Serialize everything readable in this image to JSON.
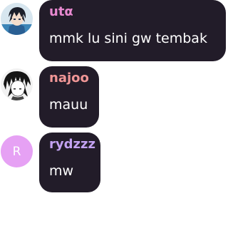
{
  "messages": [
    {
      "username": "utα",
      "username_color": "#e889d0",
      "text": "mmk lu sini gw tembak",
      "avatar": {
        "type": "image",
        "icon": "anime-boy-avatar-icon"
      }
    },
    {
      "username": "najoo",
      "username_color": "#f09696",
      "text": "mauu",
      "avatar": {
        "type": "image",
        "icon": "manga-avatar-icon"
      }
    },
    {
      "username": "rydzzz",
      "username_color": "#c3a2f2",
      "text": "mw",
      "avatar": {
        "type": "letter",
        "letter": "R",
        "color": "#e6a1f4"
      }
    }
  ]
}
